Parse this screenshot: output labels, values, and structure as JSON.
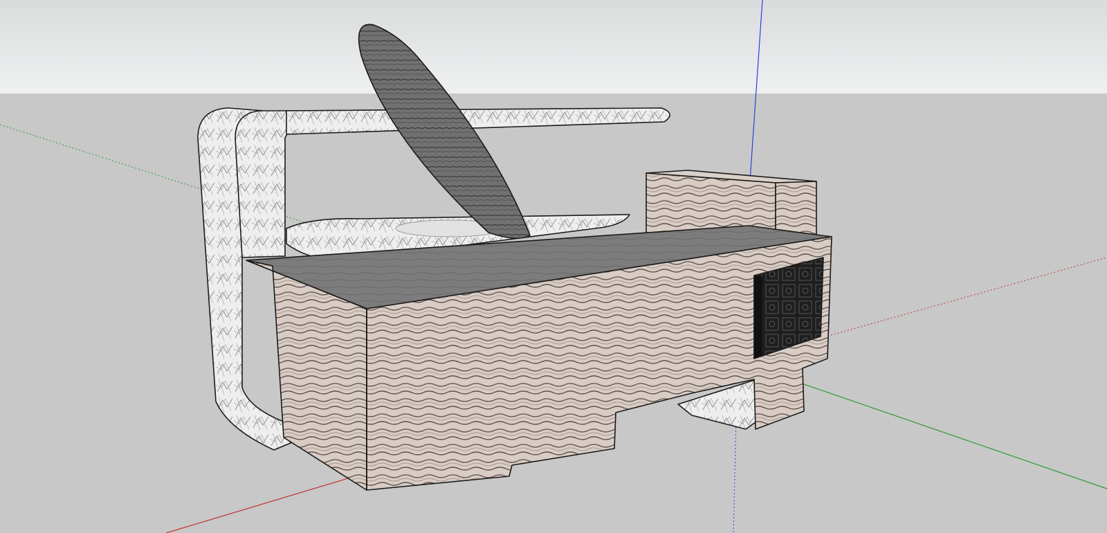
{
  "viewport": {
    "label": "",
    "colors": {
      "sky_top": "#d9dbdc",
      "sky_bottom": "#eef0f1",
      "ground": "#c8c8c8",
      "axis_red": "#c03030",
      "axis_green": "#2e9a2e",
      "axis_blue": "#2b3fd6",
      "edge": "#1a1a1a",
      "texture_fabric": "#d8ccc4",
      "texture_metal": "#ededed",
      "texture_dark_tile": "#222222",
      "texture_dark_blade": "#6f6f6f",
      "top_surface": "#7d7d7d"
    }
  },
  "model": {
    "components": [
      {
        "name": "tall-body-box",
        "texture": "fabric"
      },
      {
        "name": "raised-back-box",
        "texture": "fabric"
      },
      {
        "name": "dark-tile-window",
        "texture": "dark_tile"
      },
      {
        "name": "curved-handle-frame",
        "texture": "metal"
      },
      {
        "name": "angled-blade",
        "texture": "dark_blade"
      },
      {
        "name": "basin-tray",
        "texture": "metal"
      },
      {
        "name": "support-legs",
        "texture": "metal"
      }
    ]
  }
}
